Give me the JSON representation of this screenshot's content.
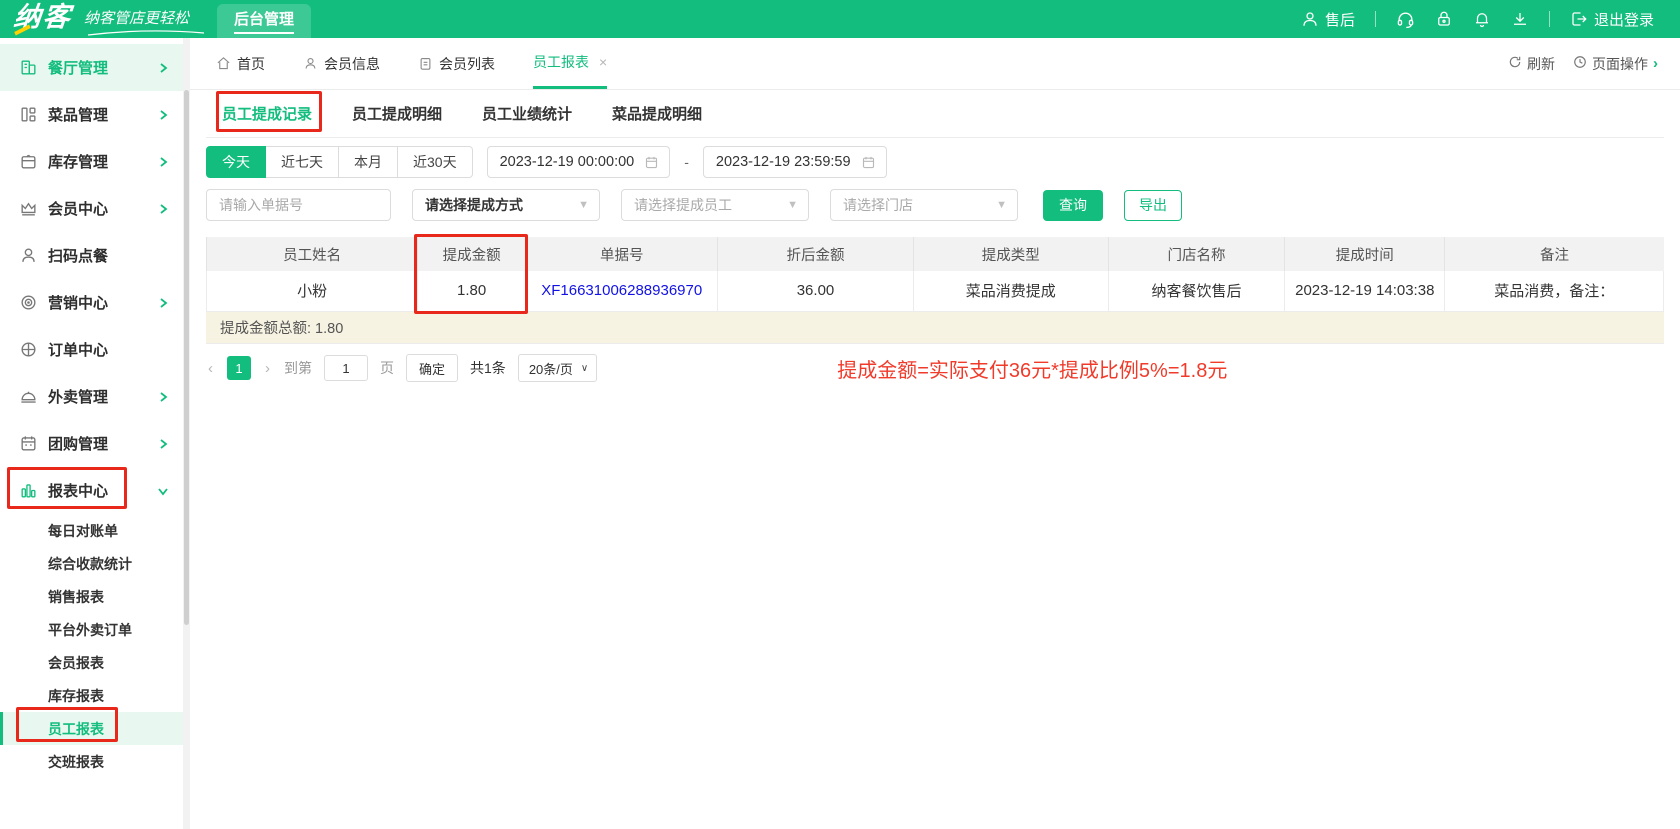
{
  "brand": {
    "logo": "纳客",
    "tagline": "纳客管店更轻松",
    "admin_tab": "后台管理"
  },
  "header_right": {
    "after_sales": "售后",
    "logout": "退出登录"
  },
  "tabbar": {
    "tabs": [
      {
        "label": "首页"
      },
      {
        "label": "会员信息"
      },
      {
        "label": "会员列表"
      },
      {
        "label": "员工报表"
      }
    ],
    "close": "×",
    "refresh": "刷新",
    "page_ops": "页面操作",
    "page_ops_chev": "›"
  },
  "sidebar": {
    "items": [
      {
        "label": "餐厅管理"
      },
      {
        "label": "菜品管理"
      },
      {
        "label": "库存管理"
      },
      {
        "label": "会员中心"
      },
      {
        "label": "扫码点餐"
      },
      {
        "label": "营销中心"
      },
      {
        "label": "订单中心"
      },
      {
        "label": "外卖管理"
      },
      {
        "label": "团购管理"
      },
      {
        "label": "报表中心"
      }
    ],
    "report_children": [
      {
        "label": "每日对账单"
      },
      {
        "label": "综合收款统计"
      },
      {
        "label": "销售报表"
      },
      {
        "label": "平台外卖订单"
      },
      {
        "label": "会员报表"
      },
      {
        "label": "库存报表"
      },
      {
        "label": "员工报表"
      },
      {
        "label": "交班报表"
      }
    ]
  },
  "filters": {
    "subtabs": [
      {
        "label": "员工提成记录"
      },
      {
        "label": "员工提成明细"
      },
      {
        "label": "员工业绩统计"
      },
      {
        "label": "菜品提成明细"
      }
    ],
    "ranges": [
      {
        "label": "今天"
      },
      {
        "label": "近七天"
      },
      {
        "label": "本月"
      },
      {
        "label": "近30天"
      }
    ],
    "date_from": "2023-12-19 00:00:00",
    "date_separator": "-",
    "date_to": "2023-12-19 23:59:59",
    "order_no_placeholder": "请输入单据号",
    "select_commission_type": "请选择提成方式",
    "select_employee": "请选择提成员工",
    "select_store": "请选择门店",
    "dropdown_arrow": "▼",
    "search_btn": "查询",
    "export_btn": "导出"
  },
  "table": {
    "headers": [
      "员工姓名",
      "提成金额",
      "单据号",
      "折后金额",
      "提成类型",
      "门店名称",
      "提成时间",
      "备注"
    ],
    "row": {
      "name": "小粉",
      "commission": "1.80",
      "order_no": "XF16631006288936970",
      "discounted_amount": "36.00",
      "commission_type": "菜品消费提成",
      "store": "纳客餐饮售后",
      "time": "2023-12-19 14:03:38",
      "remark": "菜品消费，备注："
    },
    "summary": "提成金额总额: 1.80"
  },
  "pagination": {
    "prev": "‹",
    "current_page": "1",
    "next": "›",
    "goto_label": "到第",
    "goto_value": "1",
    "page_label": "页",
    "confirm": "确定",
    "total": "共1条",
    "page_size": "20条/页",
    "select_arrow": "∨"
  },
  "annotation": "提成金额=实际支付36元*提成比例5%=1.8元",
  "colors": {
    "brand_green": "#12bd7e",
    "highlight_red": "#e9281c",
    "annotation_red": "#f03b2b",
    "link_blue": "#1212e6"
  }
}
